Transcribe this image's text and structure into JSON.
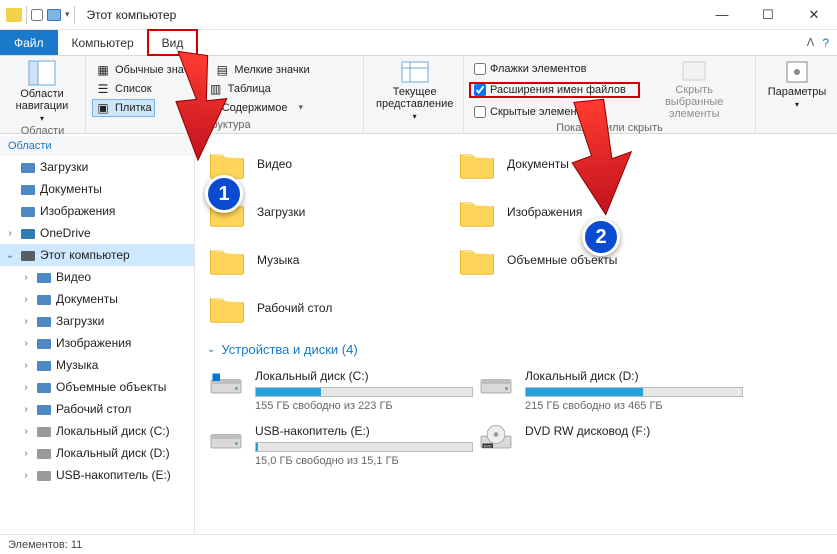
{
  "window": {
    "title": "Этот компьютер"
  },
  "tabs": {
    "file": "Файл",
    "computer": "Компьютер",
    "view": "Вид"
  },
  "ribbon": {
    "nav": {
      "label": "Области\nнавигации",
      "group": "Области"
    },
    "layout": {
      "extra_large": "Обычные значки",
      "medium": "Мелкие значки",
      "list": "Список",
      "table": "Таблица",
      "tile": "Плитка",
      "content": "Содержимое",
      "group": "Структура"
    },
    "currentview": {
      "label": "Текущее\nпредставление"
    },
    "showhide": {
      "item_checkboxes": "Флажки элементов",
      "file_ext": "Расширения имен файлов",
      "hidden": "Скрытые элементы",
      "hide_selected": "Скрыть выбранные\nэлементы",
      "group": "Показать или скрыть"
    },
    "options": "Параметры"
  },
  "tree": {
    "header": "Области",
    "nodes": [
      {
        "icon": "downloads",
        "label": "Загрузки"
      },
      {
        "icon": "documents",
        "label": "Документы"
      },
      {
        "icon": "pictures",
        "label": "Изображения"
      },
      {
        "icon": "onedrive",
        "label": "OneDrive",
        "expandable": true
      },
      {
        "icon": "computer",
        "label": "Этот компьютер",
        "expanded": true,
        "selected": true
      },
      {
        "icon": "video",
        "label": "Видео",
        "indent": true
      },
      {
        "icon": "documents",
        "label": "Документы",
        "indent": true
      },
      {
        "icon": "downloads",
        "label": "Загрузки",
        "indent": true
      },
      {
        "icon": "pictures",
        "label": "Изображения",
        "indent": true
      },
      {
        "icon": "music",
        "label": "Музыка",
        "indent": true
      },
      {
        "icon": "objects3d",
        "label": "Объемные объекты",
        "indent": true
      },
      {
        "icon": "desktop",
        "label": "Рабочий стол",
        "indent": true
      },
      {
        "icon": "drive",
        "label": "Локальный диск (C:)",
        "indent": true
      },
      {
        "icon": "drive",
        "label": "Локальный диск (D:)",
        "indent": true
      },
      {
        "icon": "usb",
        "label": "USB-накопитель (E:)",
        "indent": true
      }
    ]
  },
  "content": {
    "folders": [
      {
        "name": "Видео"
      },
      {
        "name": "Документы"
      },
      {
        "name": "Загрузки"
      },
      {
        "name": "Изображения"
      },
      {
        "name": "Музыка"
      },
      {
        "name": "Объемные объекты"
      },
      {
        "name": "Рабочий стол"
      }
    ],
    "section_drives": "Устройства и диски (4)",
    "drives": [
      {
        "name": "Локальный диск (C:)",
        "free": "155 ГБ свободно из 223 ГБ",
        "fill": 30,
        "type": "hdd-win"
      },
      {
        "name": "Локальный диск (D:)",
        "free": "215 ГБ свободно из 465 ГБ",
        "fill": 54,
        "type": "hdd"
      },
      {
        "name": "USB-накопитель (E:)",
        "free": "15,0 ГБ свободно из 15,1 ГБ",
        "fill": 1,
        "type": "usb"
      },
      {
        "name": "DVD RW дисковод (F:)",
        "type": "dvd"
      }
    ]
  },
  "status": {
    "count": "Элементов: 11"
  },
  "annotations": {
    "badge1": "1",
    "badge2": "2"
  }
}
